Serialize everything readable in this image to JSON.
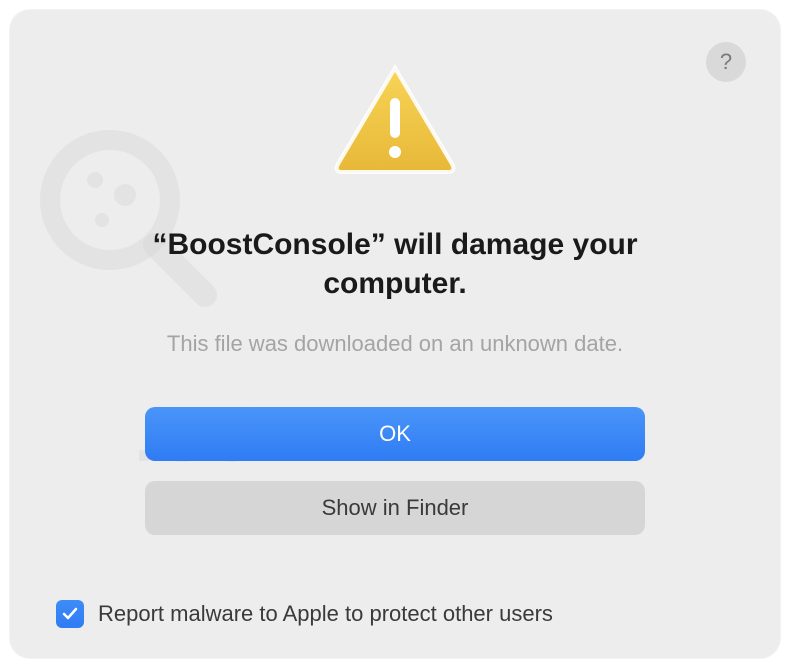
{
  "dialog": {
    "title": "“BoostConsole” will damage your computer.",
    "subtitle": "This file was downloaded on an unknown date.",
    "help_label": "?",
    "primary_button": "OK",
    "secondary_button": "Show in Finder"
  },
  "checkbox": {
    "label": "Report malware to Apple to protect other users",
    "checked": true
  },
  "icons": {
    "warning": "warning-icon",
    "checkmark": "checkmark-icon",
    "help": "help-icon"
  },
  "colors": {
    "accent": "#2f7cf4",
    "background": "#ededed",
    "secondary_button": "#d6d6d6",
    "muted_text": "#a4a4a4"
  }
}
